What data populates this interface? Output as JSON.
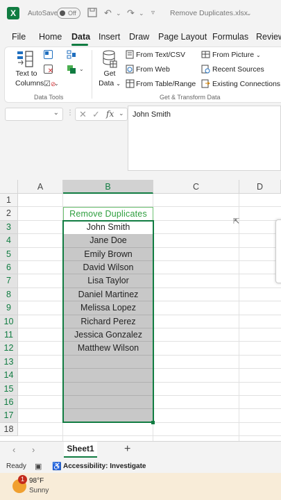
{
  "title_bar": {
    "autosave_label": "AutoSave",
    "autosave_state": "Off",
    "filename": "Remove Duplicates.xlsx"
  },
  "menu_tabs": [
    "File",
    "Home",
    "Data",
    "Insert",
    "Draw",
    "Page Layout",
    "Formulas",
    "Review"
  ],
  "active_tab": "Data",
  "ribbon": {
    "text_to_columns": [
      "Text to",
      "Columns"
    ],
    "data_tools_label": "Data Tools",
    "get_data": [
      "Get",
      "Data"
    ],
    "from_text_csv": "From Text/CSV",
    "from_web": "From Web",
    "from_table_range": "From Table/Range",
    "from_picture": "From Picture",
    "recent_sources": "Recent Sources",
    "existing_connections": "Existing Connections",
    "get_transform_label": "Get & Transform Data"
  },
  "formula_bar": {
    "fx_label": "fx",
    "value": "John Smith"
  },
  "columns": [
    "A",
    "B",
    "C",
    "D"
  ],
  "selected_column": "B",
  "rows": [
    "1",
    "2",
    "3",
    "4",
    "5",
    "6",
    "7",
    "8",
    "9",
    "10",
    "11",
    "12",
    "13",
    "14",
    "15",
    "16",
    "17",
    "18"
  ],
  "cells_B": {
    "header": "Remove Duplicates",
    "values": [
      "John Smith",
      "Jane Doe",
      "Emily Brown",
      "David Wilson",
      "Lisa Taylor",
      "Daniel Martinez",
      "Melissa Lopez",
      "Richard Perez",
      "Jessica Gonzalez",
      "Matthew Wilson"
    ]
  },
  "sheet_tabs": {
    "active": "Sheet1",
    "add_label": "+"
  },
  "status_bar": {
    "ready": "Ready",
    "accessibility": "Accessibility: Investigate"
  },
  "taskbar": {
    "badge": "1",
    "temperature": "98°F",
    "condition": "Sunny"
  },
  "colors": {
    "excel_green": "#107c41",
    "selection_gray": "#c8c8c8",
    "header_text_green": "#2e9e3e"
  }
}
